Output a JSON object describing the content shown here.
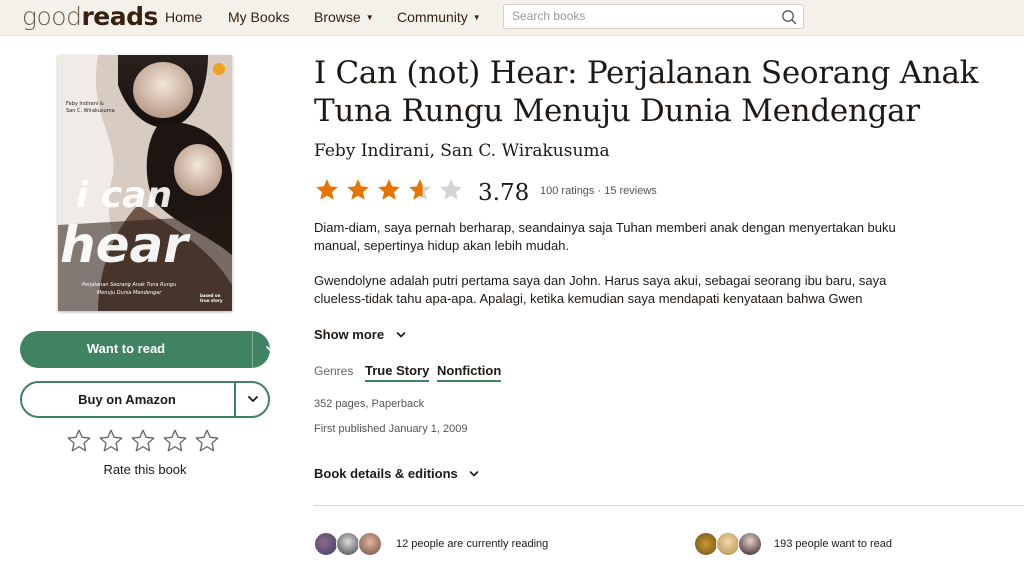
{
  "header": {
    "logo": {
      "part1": "good",
      "part2": "reads"
    },
    "nav": [
      {
        "label": "Home",
        "has_caret": false
      },
      {
        "label": "My Books",
        "has_caret": false
      },
      {
        "label": "Browse",
        "has_caret": true
      },
      {
        "label": "Community",
        "has_caret": true
      }
    ],
    "search": {
      "placeholder": "Search books",
      "value": ""
    }
  },
  "cover": {
    "authors_line1": "Feby Indirani &",
    "authors_line2": "San C. Wirakusuma",
    "title_line1": "i can",
    "title_line2": "hear",
    "subtitle_line1": "Perjalanan Seorang Anak Tuna Rungu",
    "subtitle_line2": "Menuju Dunia Mendengar",
    "badge": "based on true story"
  },
  "actions": {
    "want_to_read": "Want to read",
    "buy": "Buy on Amazon",
    "rate_label": "Rate this book",
    "rate_stars": 5
  },
  "book": {
    "title": "I Can (not) Hear: Perjalanan Seorang Anak Tuna Rungu Menuju Dunia Mendengar",
    "authors": "Feby Indirani, San C. Wirakusuma",
    "rating": 3.78,
    "rating_text": "3.78",
    "ratings_count": "100 ratings",
    "reviews_count": "15 reviews",
    "description_p1": "Diam-diam, saya pernah berharap, seandainya saja Tuhan memberi anak dengan menyertakan buku manual, sepertinya hidup akan lebih mudah.",
    "description_p2": "Gwendolyne adalah putri pertama saya dan John. Harus saya akui, sebagai seorang ibu baru, saya clueless-tidak tahu apa-apa. Apalagi, ketika kemudian saya mendapati kenyataan bahwa Gwen",
    "show_more": "Show more",
    "genres_label": "Genres",
    "genres": [
      "True Story",
      "Nonfiction"
    ],
    "pages_format": "352 pages, Paperback",
    "first_published": "First published January 1, 2009",
    "details_link": "Book details & editions"
  },
  "social": {
    "currently_reading": "12 people are currently reading",
    "want_to_read": "193 people want to read"
  },
  "colors": {
    "header_bg": "#f4f1ea",
    "brand_green": "#3f8363",
    "star_filled": "#e87400",
    "star_empty": "#d3d3d3",
    "text_dark": "#1e1915"
  },
  "icons": {
    "search": "search-icon",
    "chevron": "chevron-down-icon",
    "star": "star-icon"
  }
}
